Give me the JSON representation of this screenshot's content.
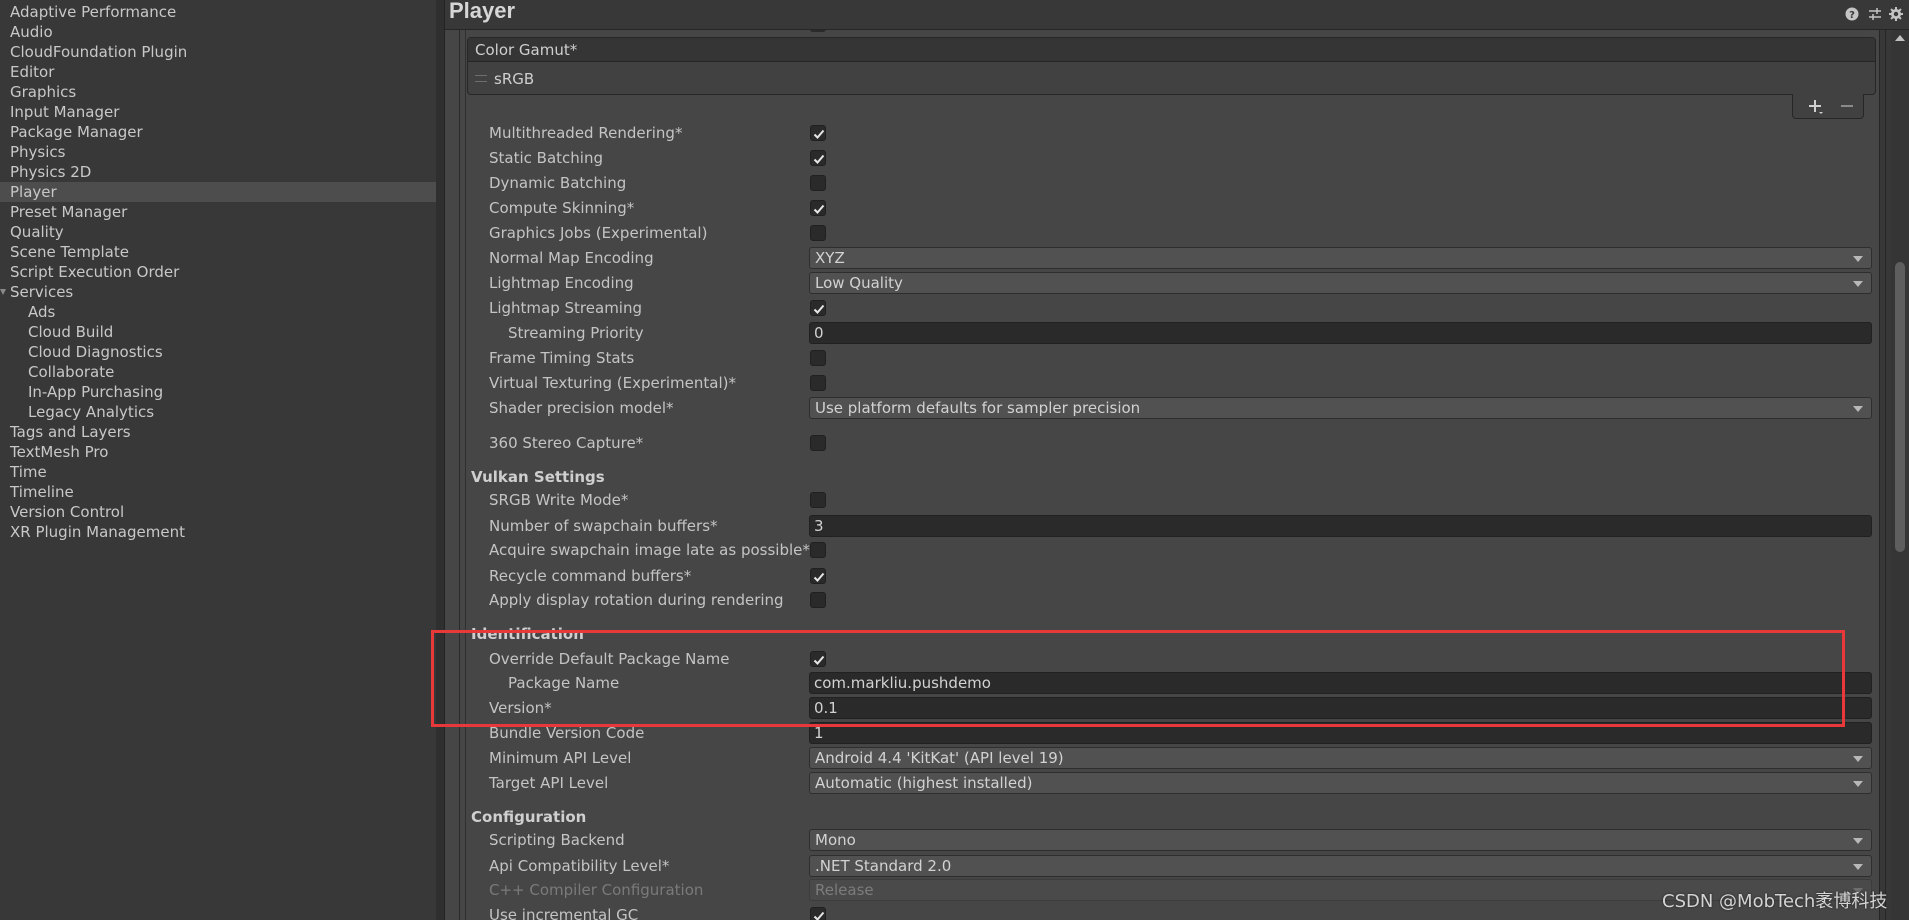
{
  "sidebar": {
    "items": [
      {
        "label": "Adaptive Performance"
      },
      {
        "label": "Audio"
      },
      {
        "label": "CloudFoundation Plugin"
      },
      {
        "label": "Editor"
      },
      {
        "label": "Graphics"
      },
      {
        "label": "Input Manager"
      },
      {
        "label": "Package Manager"
      },
      {
        "label": "Physics"
      },
      {
        "label": "Physics 2D"
      },
      {
        "label": "Player",
        "selected": true
      },
      {
        "label": "Preset Manager"
      },
      {
        "label": "Quality"
      },
      {
        "label": "Scene Template"
      },
      {
        "label": "Script Execution Order"
      },
      {
        "label": "Services",
        "expanded": true
      },
      {
        "label": "Ads",
        "child": true
      },
      {
        "label": "Cloud Build",
        "child": true
      },
      {
        "label": "Cloud Diagnostics",
        "child": true
      },
      {
        "label": "Collaborate",
        "child": true
      },
      {
        "label": "In-App Purchasing",
        "child": true
      },
      {
        "label": "Legacy Analytics",
        "child": true
      },
      {
        "label": "Tags and Layers"
      },
      {
        "label": "TextMesh Pro"
      },
      {
        "label": "Time"
      },
      {
        "label": "Timeline"
      },
      {
        "label": "Version Control"
      },
      {
        "label": "XR Plugin Management"
      }
    ]
  },
  "header": {
    "title": "Player",
    "icons": [
      "help-icon",
      "presets-icon",
      "settings-gear-icon"
    ]
  },
  "color_gamut": {
    "header": "Color Gamut*",
    "items": [
      "sRGB"
    ],
    "add_label": "+",
    "remove_label": "−"
  },
  "rendering": {
    "multithreaded_rendering": {
      "label": "Multithreaded Rendering*",
      "checked": true
    },
    "static_batching": {
      "label": "Static Batching",
      "checked": true
    },
    "dynamic_batching": {
      "label": "Dynamic Batching",
      "checked": false
    },
    "compute_skinning": {
      "label": "Compute Skinning*",
      "checked": true
    },
    "graphics_jobs": {
      "label": "Graphics Jobs (Experimental)",
      "checked": false
    },
    "normal_map_encoding": {
      "label": "Normal Map Encoding",
      "value": "XYZ"
    },
    "lightmap_encoding": {
      "label": "Lightmap Encoding",
      "value": "Low Quality"
    },
    "lightmap_streaming": {
      "label": "Lightmap Streaming",
      "checked": true
    },
    "streaming_priority": {
      "label": "Streaming Priority",
      "value": "0"
    },
    "frame_timing_stats": {
      "label": "Frame Timing Stats",
      "checked": false
    },
    "virtual_texturing": {
      "label": "Virtual Texturing (Experimental)*",
      "checked": false
    },
    "shader_precision": {
      "label": "Shader precision model*",
      "value": "Use platform defaults for sampler precision"
    },
    "stereo_capture": {
      "label": "360 Stereo Capture*",
      "checked": false
    }
  },
  "vulkan": {
    "section": "Vulkan Settings",
    "srgb_write_mode": {
      "label": "SRGB Write Mode*",
      "checked": false
    },
    "swapchain_buffers": {
      "label": "Number of swapchain buffers*",
      "value": "3"
    },
    "acquire_late": {
      "label": "Acquire swapchain image late as possible*",
      "checked": false
    },
    "recycle_buffers": {
      "label": "Recycle command buffers*",
      "checked": true
    },
    "display_rotation": {
      "label": "Apply display rotation during rendering",
      "checked": false
    }
  },
  "identification": {
    "section": "Identification",
    "override_package": {
      "label": "Override Default Package Name",
      "checked": true
    },
    "package_name": {
      "label": "Package Name",
      "value": "com.markliu.pushdemo"
    },
    "version": {
      "label": "Version*",
      "value": "0.1"
    },
    "bundle_version_code": {
      "label": "Bundle Version Code",
      "value": "1"
    },
    "min_api": {
      "label": "Minimum API Level",
      "value": "Android 4.4 'KitKat' (API level 19)"
    },
    "target_api": {
      "label": "Target API Level",
      "value": "Automatic (highest installed)"
    }
  },
  "configuration": {
    "section": "Configuration",
    "scripting_backend": {
      "label": "Scripting Backend",
      "value": "Mono"
    },
    "api_compat": {
      "label": "Api Compatibility Level*",
      "value": ".NET Standard 2.0"
    },
    "cpp_compiler": {
      "label": "C++ Compiler Configuration",
      "value": "Release",
      "disabled": true
    },
    "incremental_gc": {
      "label": "Use incremental GC",
      "checked": true
    }
  },
  "annotation": {
    "color": "#e8383a"
  },
  "watermark": "CSDN @MobTech袤博科技"
}
